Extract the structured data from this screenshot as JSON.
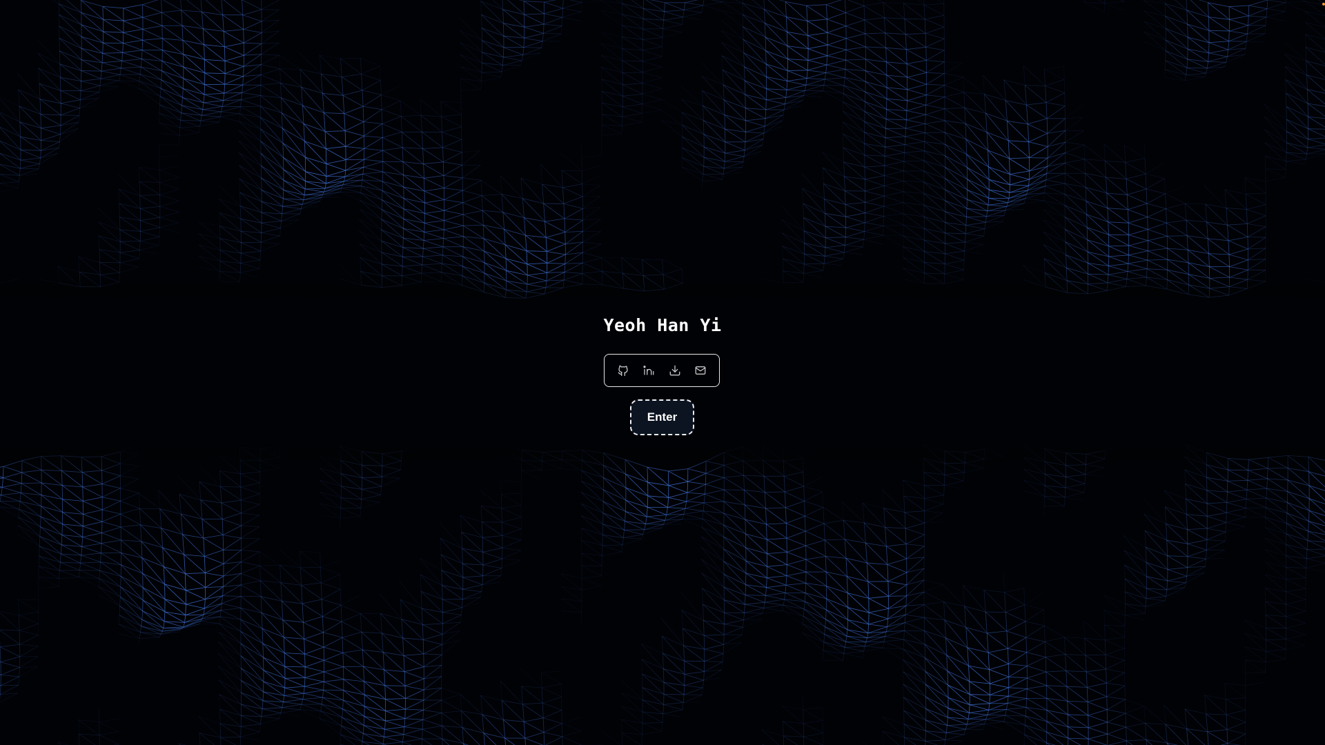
{
  "page": {
    "name": "Yeoh Han Yi",
    "enter_label": "Enter"
  },
  "links": [
    {
      "icon": "github-icon",
      "label": "GitHub"
    },
    {
      "icon": "linkedin-icon",
      "label": "LinkedIn"
    },
    {
      "icon": "download-icon",
      "label": "Download"
    },
    {
      "icon": "mail-icon",
      "label": "Email"
    }
  ],
  "colors": {
    "background": "#010206",
    "mesh": "#3e6fd1",
    "text": "#ffffff",
    "button_bg": "#0b1420",
    "accent_dot": "#ff9a2a"
  }
}
